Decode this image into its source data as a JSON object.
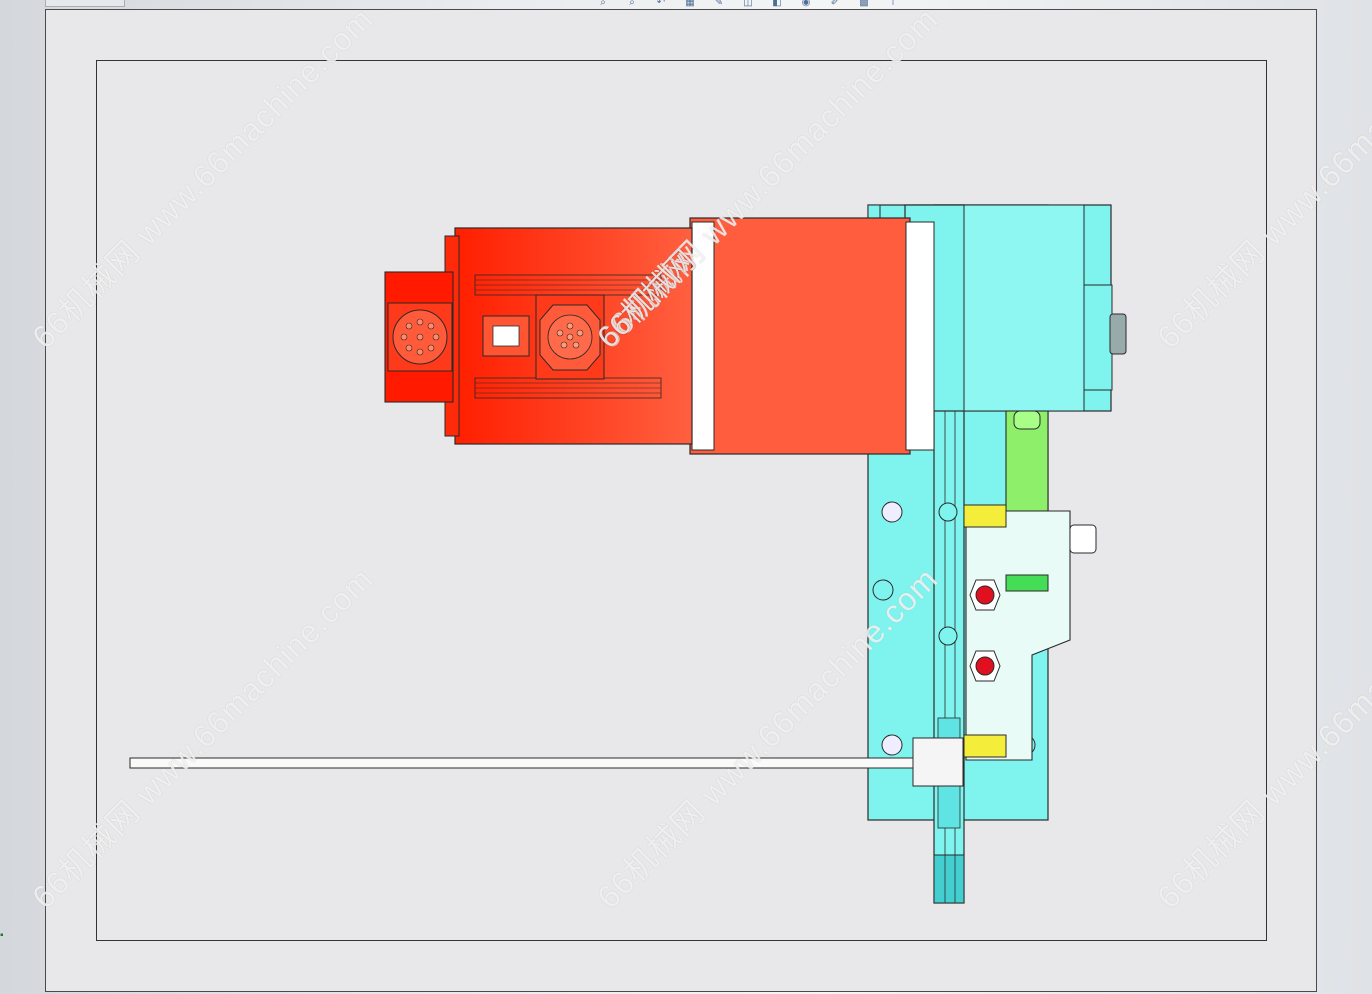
{
  "app": {
    "toolbar_icons": [
      {
        "name": "zoom-fit-icon",
        "glyph": "⌕"
      },
      {
        "name": "zoom-area-icon",
        "glyph": "⌕"
      },
      {
        "name": "previous-view-icon",
        "glyph": "↶"
      },
      {
        "name": "section-view-icon",
        "glyph": "▦"
      },
      {
        "name": "dynamic-annotation-icon",
        "glyph": "✎"
      },
      {
        "name": "view-orientation-icon",
        "glyph": "◫"
      },
      {
        "name": "display-style-icon",
        "glyph": "◧"
      },
      {
        "name": "hide-show-items-icon",
        "glyph": "◉"
      },
      {
        "name": "edit-appearance-icon",
        "glyph": "✐"
      },
      {
        "name": "apply-scene-icon",
        "glyph": "▩"
      },
      {
        "name": "view-settings-icon",
        "glyph": "⊤"
      }
    ]
  },
  "watermarks": [
    "66机械网 www.66machine.com",
    "66机械网 www.66machine.com",
    "66机械网 www.66machine.com",
    "66机械网 www.66machine.com",
    "66机械网 www.66machine.com",
    "66机械网 www.66machine.com"
  ],
  "center_label": "66机械网",
  "colors": {
    "motor_red": "#ff2a0a",
    "motor_light": "#ff6a4a",
    "cyan": "#7ff3ee",
    "cyan_dark": "#43cfd0",
    "green": "#8ef06a",
    "yellow": "#f4ee3a",
    "outline": "#2a2a2a"
  }
}
